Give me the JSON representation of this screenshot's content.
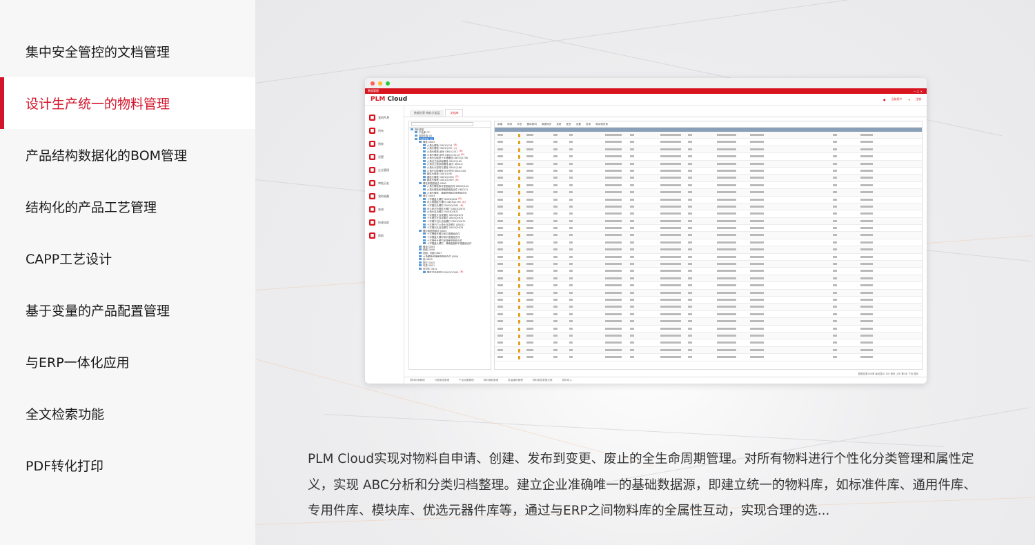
{
  "nav": {
    "items": [
      {
        "label": "集中安全管控的文档管理",
        "active": false
      },
      {
        "label": "设计生产统一的物料管理",
        "active": true
      },
      {
        "label": "产品结构数据化的BOM管理",
        "active": false
      },
      {
        "label": "结构化的产品工艺管理",
        "active": false
      },
      {
        "label": "CAPP工艺设计",
        "active": false
      },
      {
        "label": "基于变量的产品配置管理",
        "active": false
      },
      {
        "label": "与ERP一体化应用",
        "active": false
      },
      {
        "label": "全文检索功能",
        "active": false
      },
      {
        "label": "PDF转化打印",
        "active": false
      }
    ]
  },
  "screenshot": {
    "logo_prefix": "PLM",
    "logo_suffix": " Cloud",
    "window_title": "数据管理",
    "user_label": "当前用户",
    "logout_label": "注销",
    "sidebar": [
      "我的PLM",
      "所有",
      "图库",
      "设置",
      "企业管理",
      "审批历史",
      "我的收藏",
      "查询",
      "快速导航",
      "帮助"
    ],
    "tabs": [
      "数据检索-物料分类层",
      "文档库"
    ],
    "toolbar": [
      "新建",
      "修改",
      "状态",
      "删除物料",
      "数据同步",
      "变更",
      "更多",
      "设置",
      "查询",
      "相似物查询"
    ],
    "tree": [
      {
        "text": "物料类型",
        "indent": 0
      },
      {
        "text": "产品库 CP",
        "indent": 1
      },
      {
        "text": "零部件库 LB",
        "indent": 1
      },
      {
        "text": "标准件库 GB",
        "indent": 1,
        "highlight": true
      },
      {
        "text": "螺栓 GB01",
        "indent": 2
      },
      {
        "text": "六角头螺栓 GB01Q124",
        "indent": 3,
        "red": "(R)"
      },
      {
        "text": "六角头螺栓 GB01Q150",
        "indent": 3,
        "red": "(L)"
      },
      {
        "text": "六角头螺栓-细牙 GB01Q151",
        "indent": 3,
        "red": "(R)"
      },
      {
        "text": "六角头螺栓-细牙 GB01Q151G",
        "indent": 3,
        "red": "(R)"
      },
      {
        "text": "六角头加强型十字槽螺栓 GB01Q1748",
        "indent": 3
      },
      {
        "text": "六角法兰面承面螺栓 GB01Q185",
        "indent": 3
      },
      {
        "text": "六角法兰面承面螺栓-细牙 GB01Q",
        "indent": 3
      },
      {
        "text": "六角头头部带孔螺栓 GB01Q186",
        "indent": 3
      },
      {
        "text": "六角头加强螺栓-加大系列 GB01Q18",
        "indent": 3
      },
      {
        "text": "圆柱头螺栓 GB01Q190",
        "indent": 3
      },
      {
        "text": "圆柱头螺栓 GB01Q1908",
        "indent": 3,
        "red": "(Z)"
      },
      {
        "text": "圆柱头螺栓 GB01Q1909",
        "indent": 3,
        "red": "(R)"
      },
      {
        "text": "螺柱和垫圈组合 GB02",
        "indent": 2
      },
      {
        "text": "六角头螺栓和平垫圈组合件 GB02Q144",
        "indent": 3
      },
      {
        "text": "六角头螺栓和弹簧垫圈组合件 GB02Q1",
        "indent": 3
      },
      {
        "text": "六角头螺栓、弹簧垫圈和平垫圈组合件",
        "indent": 3
      },
      {
        "text": "螺钉 GB03",
        "indent": 2
      },
      {
        "text": "十字槽盘头螺钉 GB03Q818",
        "indent": 3,
        "red": "(R)"
      },
      {
        "text": "内六角圆柱头螺钉 GB03Q2195",
        "indent": 3,
        "red": "(R)"
      },
      {
        "text": "十字槽沉头螺钉 GB03Q2562",
        "indent": 3,
        "red": "(R)"
      },
      {
        "text": "内六角花形圆柱头螺钉 GB03Q2671",
        "indent": 3
      },
      {
        "text": "六角头自攻螺钉 GB03Q2672",
        "indent": 3
      },
      {
        "text": "十字槽盘头自攻螺钉 GB03Q2673",
        "indent": 3
      },
      {
        "text": "十字槽沉头自攻螺钉 GB03Q2674",
        "indent": 3
      },
      {
        "text": "十字槽半沉头自攻螺钉 GB03Q2675",
        "indent": 3
      },
      {
        "text": "十字槽凹穴六角头自攻螺钉 GB03Q",
        "indent": 3
      },
      {
        "text": "十字槽沉头自攻螺钉 GB03Q2676",
        "indent": 3
      },
      {
        "text": "螺钉和垫圈组合 GB04",
        "indent": 2
      },
      {
        "text": "十字槽盘头螺钉和平垫圈组合件",
        "indent": 3
      },
      {
        "text": "十字槽盘头螺钉和平垫圈组合件",
        "indent": 3
      },
      {
        "text": "十字槽盘头螺钉和弹簧垫圈组合件",
        "indent": 3
      },
      {
        "text": "十字槽盘头螺钉、弹簧垫圈和平垫圈组合件",
        "indent": 3
      },
      {
        "text": "螺母 GB05",
        "indent": 2
      },
      {
        "text": "垫圈 GB06",
        "indent": 2
      },
      {
        "text": "挡圈、挡圈 GB07",
        "indent": 2
      },
      {
        "text": "六角螺母和弹簧垫圈组合件 GB08",
        "indent": 2
      },
      {
        "text": "销 GB09",
        "indent": 2
      },
      {
        "text": "铆钉 GB10",
        "indent": 2
      },
      {
        "text": "环类 GB11",
        "indent": 2
      },
      {
        "text": "密封件 GB12",
        "indent": 2
      },
      {
        "text": "圆柱式自制密封 GB12Q7009",
        "indent": 3,
        "red": "(R)"
      }
    ],
    "status_text": "数据总数240条 每页显示 100 首页 上页 第1页 下页 尾页",
    "bottom_tabs": [
      "物料申请管理",
      "分类属性管理",
      "产品设置管理",
      "物料通知管理",
      "批量编码管理",
      "物料属性数据交换",
      "物料导入"
    ]
  },
  "description": "PLM Cloud实现对物料自申请、创建、发布到变更、废止的全生命周期管理。对所有物料进行个性化分类管理和属性定义，实现 ABC分析和分类归档整理。建立企业准确唯一的基础数据源，即建立统一的物料库，如标准件库、通用件库、专用件库、模块库、优选元器件库等，通过与ERP之间物料库的全属性互动，实现合理的选...",
  "colors": {
    "accent": "#d3142a",
    "window_red": "#d8141f"
  }
}
